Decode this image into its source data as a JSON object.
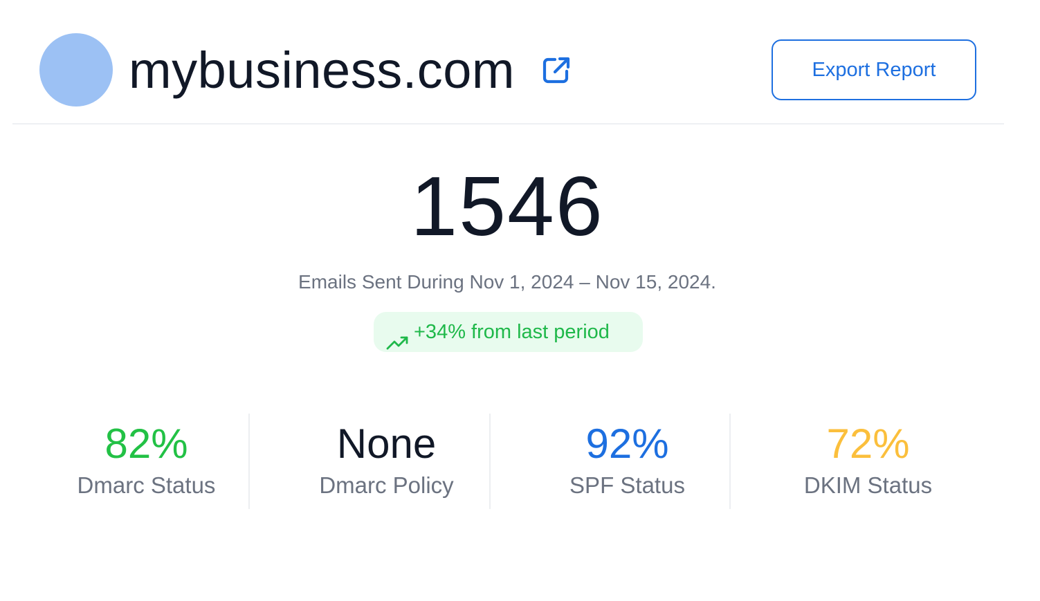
{
  "header": {
    "domain": "mybusiness.com",
    "export_label": "Export Report",
    "avatar_color": "#9cc1f4",
    "link_icon": "external-link-icon"
  },
  "summary": {
    "emails_sent": "1546",
    "period_text": "Emails Sent During Nov 1, 2024 – Nov 15, 2024.",
    "trend_text": "+34% from last period",
    "trend_icon": "trending-up-icon"
  },
  "stats": [
    {
      "value": "82%",
      "label": "Dmarc Status",
      "color": "#22c145"
    },
    {
      "value": "None",
      "label": "Dmarc Policy",
      "color": "#111827"
    },
    {
      "value": "92%",
      "label": "SPF Status",
      "color": "#1d6fe0"
    },
    {
      "value": "72%",
      "label": "DKIM Status",
      "color": "#fbbf3c"
    }
  ],
  "colors": {
    "accent": "#1d6fe0",
    "positive": "#1fb84a",
    "positive_bg": "#e8fbee",
    "muted_text": "#6b7280"
  }
}
